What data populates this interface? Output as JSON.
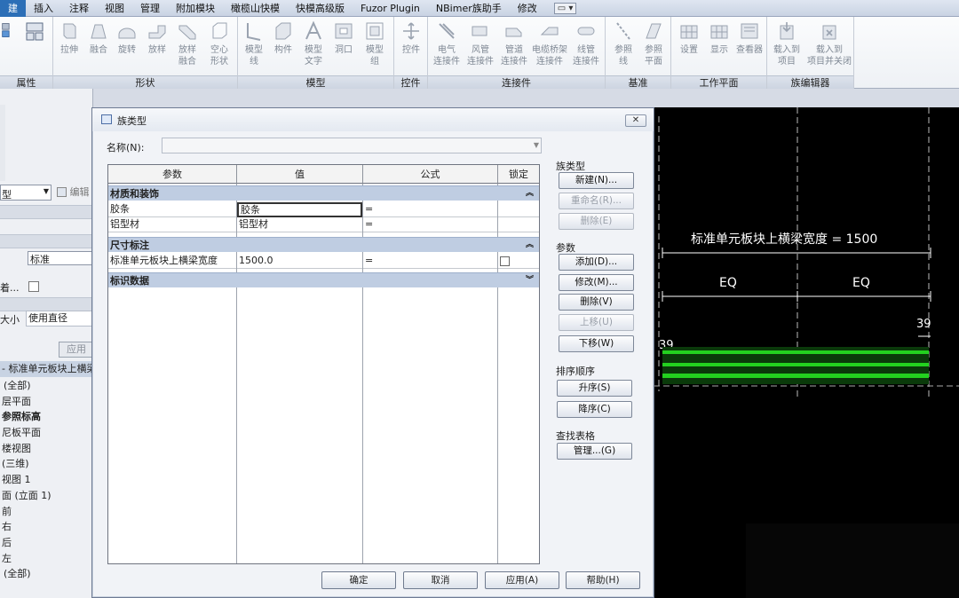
{
  "menubar": {
    "tabs": [
      "建",
      "插入",
      "注释",
      "视图",
      "管理",
      "附加模块",
      "橄榄山快模",
      "快模高级版",
      "Fuzor Plugin",
      "NBimer族助手",
      "修改"
    ],
    "active_index": 0,
    "extra": "▭ ▾"
  },
  "ribbon": {
    "groups": [
      {
        "label": "属性"
      },
      {
        "label": "形状",
        "buttons": [
          "拉伸",
          "融合",
          "旋转",
          "放样",
          "放样\n融合",
          "空心\n形状"
        ]
      },
      {
        "label": "模型",
        "buttons": [
          "模型\n线",
          "构件",
          "模型\n文字",
          "洞口",
          "模型\n组"
        ]
      },
      {
        "label": "控件",
        "buttons": [
          "控件"
        ]
      },
      {
        "label": "连接件",
        "buttons": [
          "电气\n连接件",
          "风管\n连接件",
          "管道\n连接件",
          "电缆桥架\n连接件",
          "线管\n连接件"
        ]
      },
      {
        "label": "基准",
        "buttons": [
          "参照\n线",
          "参照\n平面"
        ]
      },
      {
        "label": "工作平面",
        "buttons": [
          "设置",
          "显示",
          "查看器"
        ]
      },
      {
        "label": "族编辑器",
        "buttons": [
          "载入到\n项目",
          "载入到\n项目并关闭"
        ]
      }
    ]
  },
  "left_panel": {
    "type_select_suffix": "型",
    "edit_label": "编辑",
    "standard_value": "标准",
    "attach_label": "着...",
    "size_label": "大小",
    "size_value": "使用直径",
    "apply_label": "应用",
    "browser_title": "- 标准单元板块上横梁...",
    "tree": [
      "(全部)",
      "层平面",
      "参照标高",
      "尼板平面",
      "楼视图",
      "(三维)",
      "视图 1",
      "面 (立面 1)",
      "前",
      "右",
      "后",
      "左",
      "(全部)"
    ]
  },
  "dialog": {
    "title": "族类型",
    "close": "✕",
    "name_label": "名称(N):",
    "name_value": "",
    "columns": [
      "参数",
      "值",
      "公式",
      "锁定"
    ],
    "sections": [
      {
        "title": "材质和装饰",
        "rows": [
          {
            "param": "胶条",
            "value": "胶条",
            "formula": "="
          },
          {
            "param": "铝型材",
            "value": "铝型材",
            "formula": "="
          }
        ]
      },
      {
        "title": "尺寸标注",
        "rows": [
          {
            "param": "标准单元板块上横梁宽度",
            "value": "1500.0",
            "formula": "="
          }
        ]
      },
      {
        "title": "标识数据",
        "rows": []
      }
    ],
    "family_types": {
      "label": "族类型",
      "new": "新建(N)...",
      "rename": "重命名(R)...",
      "delete": "删除(E)"
    },
    "parameters": {
      "label": "参数",
      "add": "添加(D)...",
      "modify": "修改(M)...",
      "remove": "删除(V)",
      "move_up": "上移(U)",
      "move_down": "下移(W)"
    },
    "sort": {
      "label": "排序顺序",
      "ascending": "升序(S)",
      "descending": "降序(C)"
    },
    "lookup": {
      "label": "查找表格",
      "manage": "管理...(G)"
    },
    "footer": {
      "ok": "确定",
      "cancel": "取消",
      "apply": "应用(A)",
      "help": "帮助(H)"
    }
  },
  "canvas": {
    "dimension_label": "标准单元板块上横梁宽度 = 1500",
    "eq_left": "EQ",
    "eq_right": "EQ",
    "dim_left": "39",
    "dim_right": "39",
    "beam_color": "#23d11f",
    "line_color": "#ffffff"
  }
}
